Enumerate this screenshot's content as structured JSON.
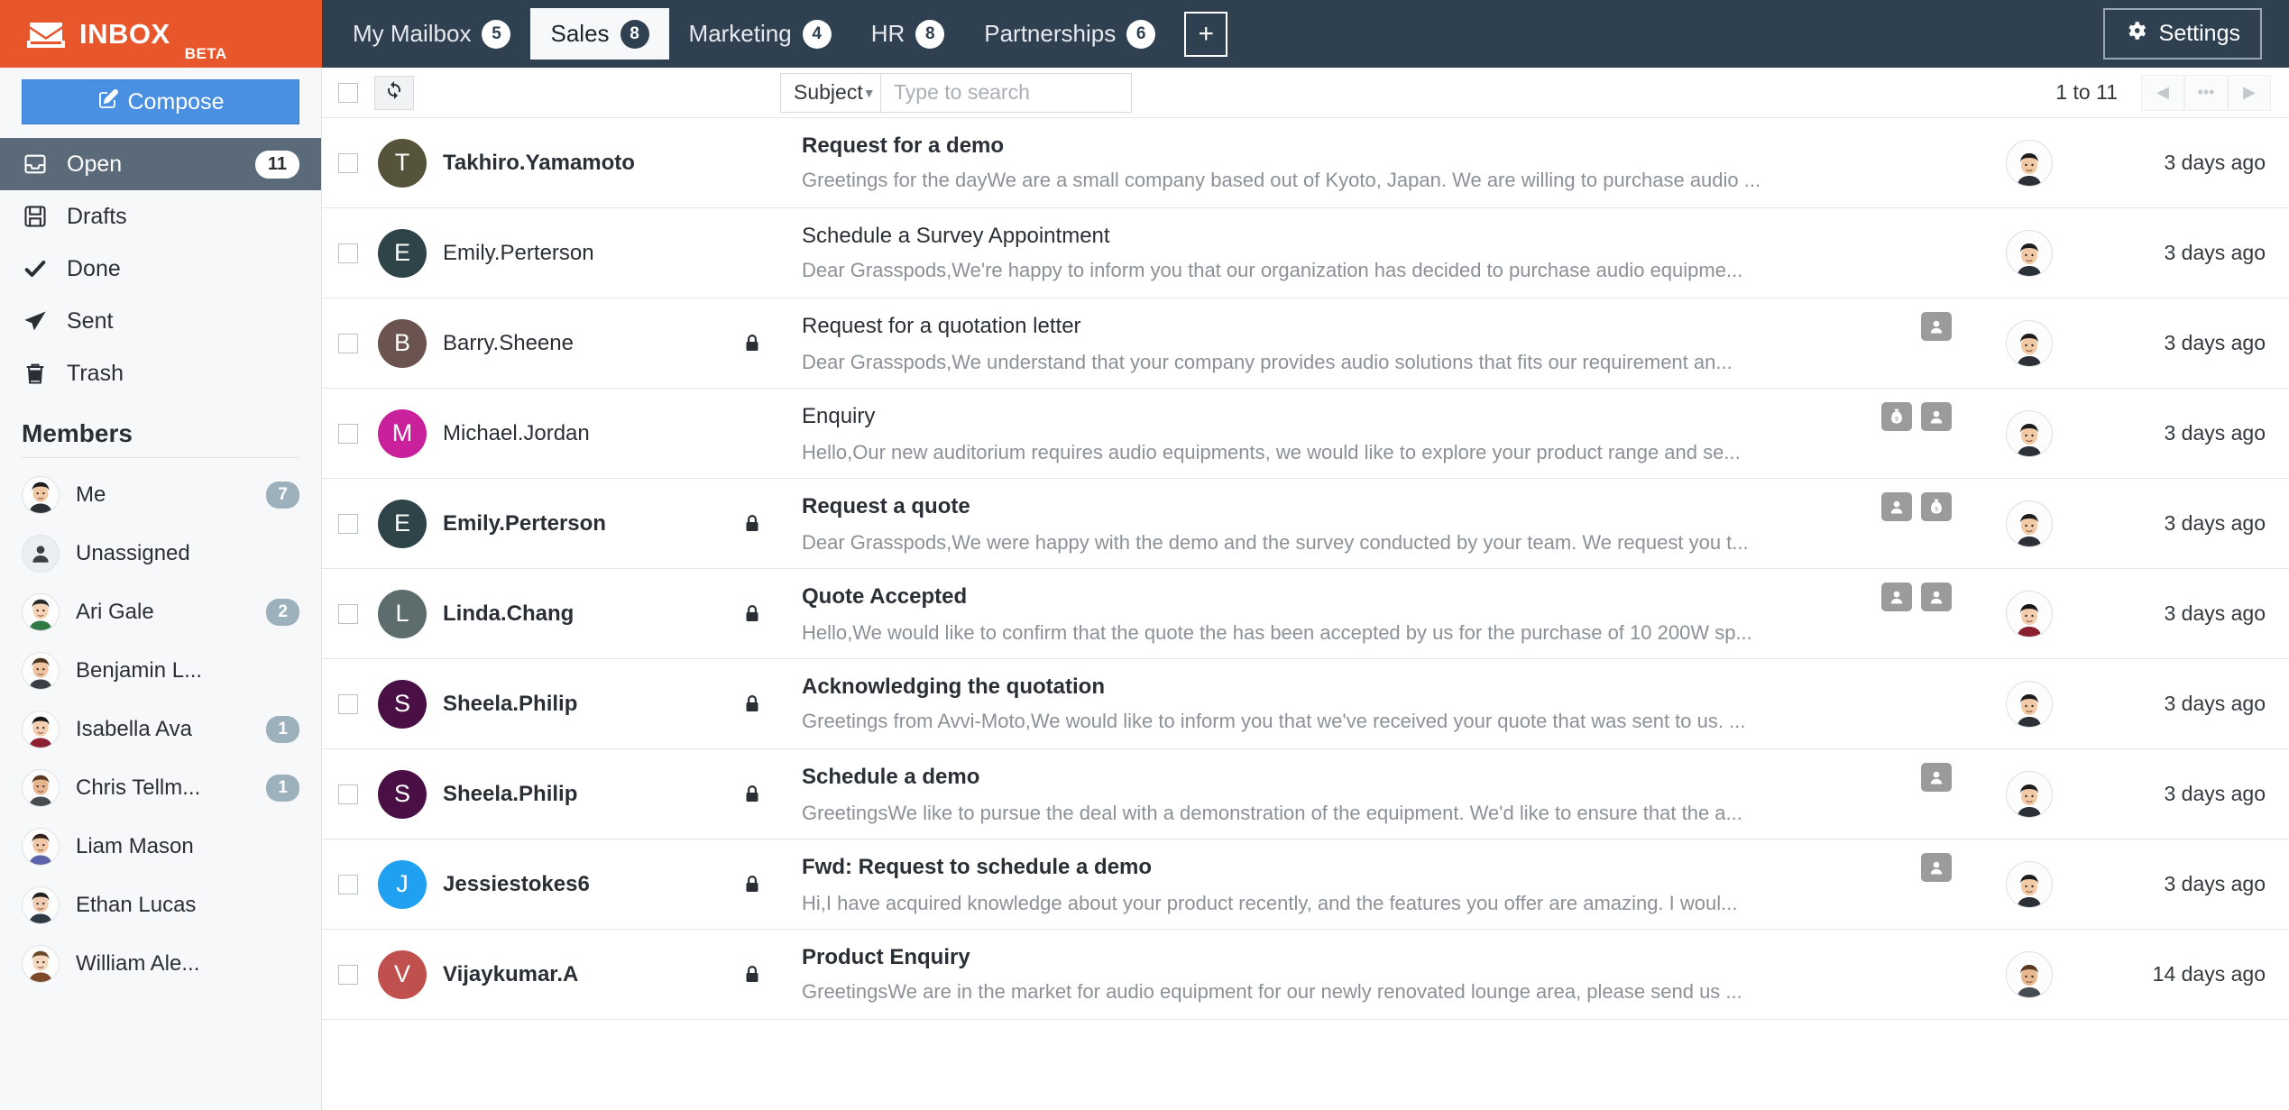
{
  "brand": {
    "name": "INBOX",
    "beta": "BETA",
    "icon": "envelope-icon"
  },
  "tabs": [
    {
      "label": "My Mailbox",
      "count": "5",
      "active": false
    },
    {
      "label": "Sales",
      "count": "8",
      "active": true
    },
    {
      "label": "Marketing",
      "count": "4",
      "active": false
    },
    {
      "label": "HR",
      "count": "8",
      "active": false
    },
    {
      "label": "Partnerships",
      "count": "6",
      "active": false
    }
  ],
  "add_tab_label": "+",
  "settings": {
    "label": "Settings",
    "icon": "gear-icon"
  },
  "sidebar": {
    "compose": {
      "label": "Compose",
      "icon": "compose-pencil-icon"
    },
    "nav": [
      {
        "label": "Open",
        "count": "11",
        "icon": "inbox-icon",
        "active": true
      },
      {
        "label": "Drafts",
        "count": "",
        "icon": "floppy-disk-icon",
        "active": false
      },
      {
        "label": "Done",
        "count": "",
        "icon": "check-icon",
        "active": false
      },
      {
        "label": "Sent",
        "count": "",
        "icon": "paper-plane-icon",
        "active": false
      },
      {
        "label": "Trash",
        "count": "",
        "icon": "trash-icon",
        "active": false
      }
    ],
    "members_title": "Members",
    "members": [
      {
        "name": "Me",
        "count": "7",
        "avatar": "photo-avatar"
      },
      {
        "name": "Unassigned",
        "count": "",
        "avatar": "person-silhouette-icon"
      },
      {
        "name": "Ari Gale",
        "count": "2",
        "avatar": "photo-avatar"
      },
      {
        "name": "Benjamin L...",
        "count": "",
        "avatar": "photo-avatar"
      },
      {
        "name": "Isabella Ava",
        "count": "1",
        "avatar": "photo-avatar"
      },
      {
        "name": "Chris Tellm...",
        "count": "1",
        "avatar": "photo-avatar"
      },
      {
        "name": "Liam Mason",
        "count": "",
        "avatar": "photo-avatar"
      },
      {
        "name": "Ethan Lucas",
        "count": "",
        "avatar": "photo-avatar"
      },
      {
        "name": "William Ale...",
        "count": "",
        "avatar": "photo-avatar"
      }
    ]
  },
  "toolbar": {
    "refresh_icon": "refresh-icon",
    "search_field": "Subject",
    "search_placeholder": "Type to search",
    "search_value": "",
    "pager_label": "1 to 11",
    "prev_icon": "◀",
    "more_icon": "•••",
    "next_icon": "▶"
  },
  "emails": [
    {
      "sender": "Takhiro.Yamamoto",
      "initial": "T",
      "color": "#55543a",
      "subject": "Request for a demo",
      "preview": "Greetings for the dayWe are a small company based out of Kyoto, Japan. We are willing to purchase audio ...",
      "time": "3 days ago",
      "locked": false,
      "unread": true,
      "badges": []
    },
    {
      "sender": "Emily.Perterson",
      "initial": "E",
      "color": "#2f4448",
      "subject": "Schedule a Survey Appointment",
      "preview": "Dear Grasspods,We're happy to inform you that our organization has decided to purchase audio equipme...",
      "time": "3 days ago",
      "locked": false,
      "unread": false,
      "badges": []
    },
    {
      "sender": "Barry.Sheene",
      "initial": "B",
      "color": "#6b534f",
      "subject": "Request for a quotation letter",
      "preview": "Dear Grasspods,We understand that your company provides audio solutions that fits our requirement an...",
      "time": "3 days ago",
      "locked": true,
      "unread": false,
      "badges": [
        "contact-icon"
      ]
    },
    {
      "sender": "Michael.Jordan",
      "initial": "M",
      "color": "#c8219b",
      "subject": "Enquiry",
      "preview": "Hello,Our new auditorium requires audio equipments, we would like to explore your product range and se...",
      "time": "3 days ago",
      "locked": false,
      "unread": false,
      "badges": [
        "money-bag-icon",
        "contact-icon"
      ]
    },
    {
      "sender": "Emily.Perterson",
      "initial": "E",
      "color": "#2f4448",
      "subject": "Request a quote",
      "preview": "Dear Grasspods,We were happy with the demo and the survey conducted by your team. We request you t...",
      "time": "3 days ago",
      "locked": true,
      "unread": true,
      "badges": [
        "contact-icon",
        "money-bag-icon"
      ]
    },
    {
      "sender": "Linda.Chang",
      "initial": "L",
      "color": "#5d6d6e",
      "subject": "Quote Accepted",
      "preview": "Hello,We would like to confirm that the quote the has been accepted by us for the purchase of 10 200W sp...",
      "time": "3 days ago",
      "locked": true,
      "unread": true,
      "badges": [
        "contact-icon",
        "contact-icon"
      ]
    },
    {
      "sender": "Sheela.Philip",
      "initial": "S",
      "color": "#4a1046",
      "subject": "Acknowledging the quotation",
      "preview": "Greetings from Avvi-Moto,We would like to inform you that we've received your quote that was sent to us. ...",
      "time": "3 days ago",
      "locked": true,
      "unread": true,
      "badges": []
    },
    {
      "sender": "Sheela.Philip",
      "initial": "S",
      "color": "#4a1046",
      "subject": "Schedule a demo",
      "preview": "GreetingsWe like to pursue the deal with a demonstration of the equipment. We'd like to ensure that the a...",
      "time": "3 days ago",
      "locked": true,
      "unread": true,
      "badges": [
        "contact-icon"
      ]
    },
    {
      "sender": "Jessiestokes6",
      "initial": "J",
      "color": "#20a0f0",
      "subject": "Fwd: Request to schedule a demo",
      "preview": "Hi,I have acquired knowledge about your product recently, and the features you offer are amazing. I woul...",
      "time": "3 days ago",
      "locked": true,
      "unread": true,
      "badges": [
        "contact-icon"
      ]
    },
    {
      "sender": "Vijaykumar.A",
      "initial": "V",
      "color": "#c0504d",
      "subject": "Product Enquiry",
      "preview": "GreetingsWe are in the market for audio equipment for our newly renovated lounge area, please send us ...",
      "time": "14 days ago",
      "locked": true,
      "unread": true,
      "badges": []
    }
  ]
}
